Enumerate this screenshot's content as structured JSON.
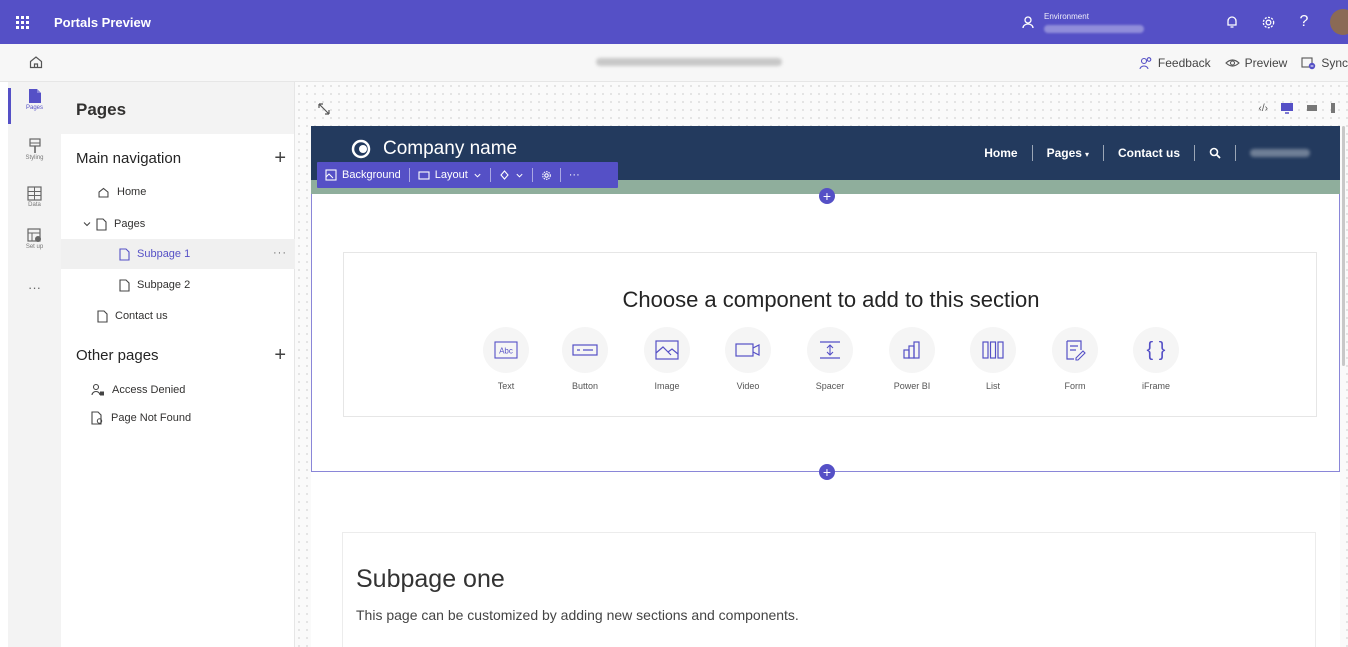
{
  "app": {
    "title": "Portals Preview"
  },
  "topbar": {
    "environment_label": "Environment"
  },
  "commandbar": {
    "feedback": "Feedback",
    "preview": "Preview",
    "sync": "Sync"
  },
  "rail": {
    "items": [
      {
        "label": "Pages",
        "icon": "page-icon"
      },
      {
        "label": "Styling",
        "icon": "paint-icon"
      },
      {
        "label": "Data",
        "icon": "table-icon"
      },
      {
        "label": "Set up",
        "icon": "setup-icon"
      }
    ],
    "more": "···"
  },
  "panel": {
    "title": "Pages",
    "main_nav": "Main navigation",
    "other_pages": "Other pages",
    "main_items": [
      {
        "label": "Home"
      },
      {
        "label": "Pages"
      },
      {
        "label": "Subpage 1"
      },
      {
        "label": "Subpage 2"
      },
      {
        "label": "Contact us"
      }
    ],
    "other_items": [
      {
        "label": "Access Denied"
      },
      {
        "label": "Page Not Found"
      }
    ],
    "row_more": "···"
  },
  "site": {
    "company": "Company name",
    "nav": {
      "home": "Home",
      "pages": "Pages",
      "contact": "Contact us"
    }
  },
  "section_toolbar": {
    "background": "Background",
    "layout": "Layout",
    "more": "···"
  },
  "chooser": {
    "title": "Choose a component to add to this section",
    "components": [
      {
        "label": "Text",
        "icon": "text-icon"
      },
      {
        "label": "Button",
        "icon": "button-icon"
      },
      {
        "label": "Image",
        "icon": "image-icon"
      },
      {
        "label": "Video",
        "icon": "video-icon"
      },
      {
        "label": "Spacer",
        "icon": "spacer-icon"
      },
      {
        "label": "Power BI",
        "icon": "powerbi-icon"
      },
      {
        "label": "List",
        "icon": "list-icon"
      },
      {
        "label": "Form",
        "icon": "form-icon"
      },
      {
        "label": "iFrame",
        "icon": "iframe-icon"
      }
    ]
  },
  "subpage": {
    "title": "Subpage one",
    "description": "This page can be customized by adding new sections and components."
  },
  "colors": {
    "accent": "#5550c6",
    "header_navy": "#233a5e",
    "strip_green": "#8fae9c"
  }
}
